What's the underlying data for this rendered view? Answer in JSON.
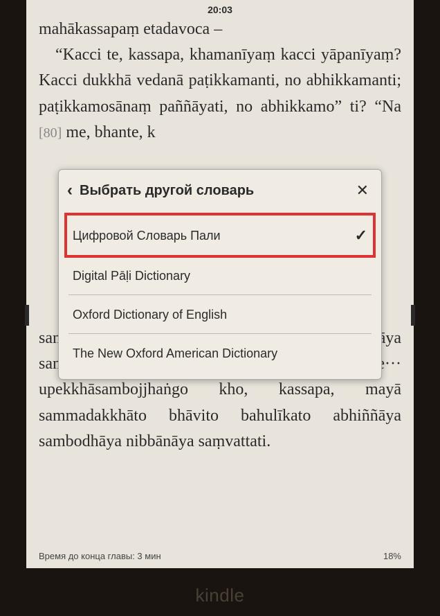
{
  "status": {
    "time": "20:03"
  },
  "reader": {
    "line1": "mahākassapaṃ etadavoca –",
    "body": " “Kacci te, kassapa, khamanīyaṃ kacci yāpanīyaṃ? Kacci dukkhā vedanā paṭikkamanti, no abhikkamanti; paṭikkamosānaṃ paññāyati, no abhikkamo” ti? “Na",
    "ref": "[80]",
    "body2": "me, bhante, k",
    "body3": "Sı",
    "body4": "sammadakkhāto bhāvito bahulīkato abhiññāya sambodhāya nibbānāya saṃvattati···pe··· upekkhāsambojjhaṅgo kho, kassapa, mayā sammadakkhāto bhāvito bahulīkato abhiññāya sambodhāya nibbānāya saṃvattati."
  },
  "popup": {
    "title": "Выбрать другой словарь",
    "items": [
      {
        "label": "Цифровой Словарь Пали",
        "selected": true
      },
      {
        "label": "Digital Pāḷi Dictionary",
        "selected": false
      },
      {
        "label": "Oxford Dictionary of English",
        "selected": false
      },
      {
        "label": "The New Oxford American Dictionary",
        "selected": false
      }
    ]
  },
  "footer": {
    "time_left": "Время до конца главы: 3 мин",
    "progress": "18%"
  },
  "brand": "kindle"
}
